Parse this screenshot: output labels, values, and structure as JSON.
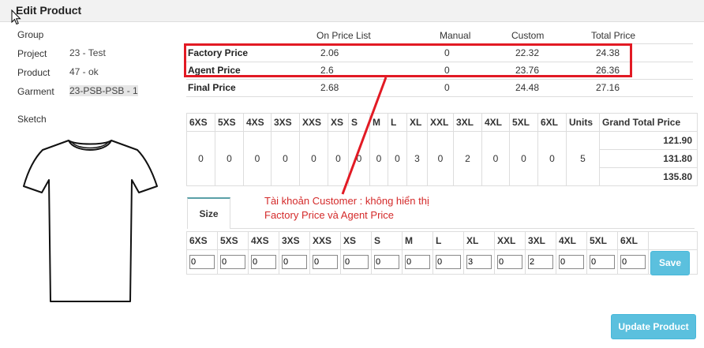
{
  "header": {
    "title": "Edit Product"
  },
  "info": {
    "group_label": "Group",
    "project_label": "Project",
    "project_value": "23 - Test",
    "product_label": "Product",
    "product_value": "47 - ok",
    "garment_label": "Garment",
    "garment_value": "23-PSB-PSB - 1",
    "sketch_label": "Sketch"
  },
  "price_table": {
    "headers": [
      "On Price List",
      "Manual",
      "Custom",
      "Total Price"
    ],
    "rows": [
      {
        "name": "Factory Price",
        "on_price_list": "2.06",
        "manual": "0",
        "custom": "22.32",
        "total": "24.38"
      },
      {
        "name": "Agent Price",
        "on_price_list": "2.6",
        "manual": "0",
        "custom": "23.76",
        "total": "26.36"
      },
      {
        "name": "Final Price",
        "on_price_list": "2.68",
        "manual": "0",
        "custom": "24.48",
        "total": "27.16"
      }
    ]
  },
  "annotation": {
    "line1": "Tài khoản Customer : không hiển thị",
    "line2": "Factory Price và Agent Price",
    "color": "#d42a2a"
  },
  "size_totals": {
    "headers": [
      "6XS",
      "5XS",
      "4XS",
      "3XS",
      "XXS",
      "XS",
      "S",
      "M",
      "L",
      "XL",
      "XXL",
      "3XL",
      "4XL",
      "5XL",
      "6XL",
      "Units",
      "Grand Total Price"
    ],
    "values": [
      "0",
      "0",
      "0",
      "0",
      "0",
      "0",
      "0",
      "0",
      "0",
      "3",
      "0",
      "2",
      "0",
      "0",
      "0",
      "5"
    ],
    "grand_totals": [
      "121.90",
      "131.80",
      "135.80"
    ]
  },
  "size_tab": {
    "label": "Size"
  },
  "size_edit": {
    "headers": [
      "6XS",
      "5XS",
      "4XS",
      "3XS",
      "XXS",
      "XS",
      "S",
      "M",
      "L",
      "XL",
      "XXL",
      "3XL",
      "4XL",
      "5XL",
      "6XL"
    ],
    "values": [
      "0",
      "0",
      "0",
      "0",
      "0",
      "0",
      "0",
      "0",
      "0",
      "3",
      "0",
      "2",
      "0",
      "0",
      "0"
    ],
    "save_label": "Save"
  },
  "update_button": {
    "label": "Update Product"
  },
  "colors": {
    "accent_button": "#5bc0de",
    "highlight_box": "#e21a24",
    "tab_top_border": "#5aa0a7"
  }
}
